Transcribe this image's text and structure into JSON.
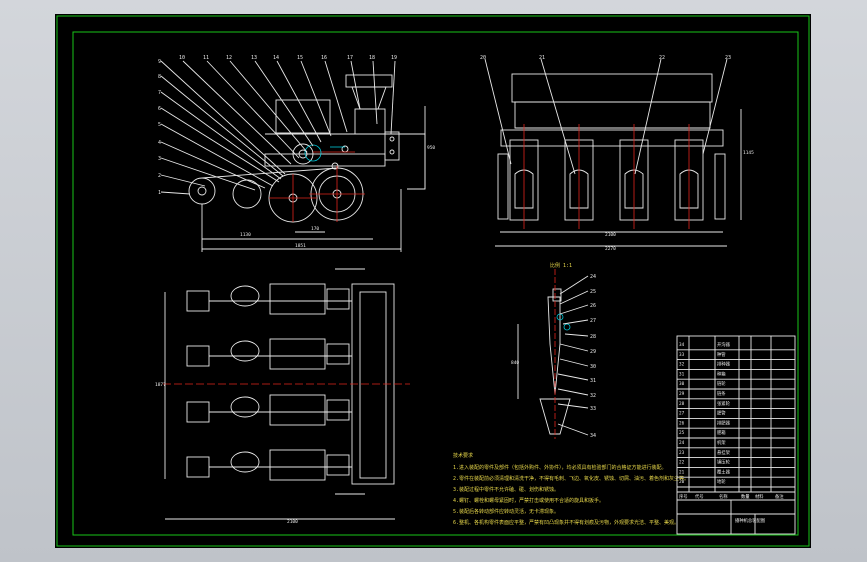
{
  "title_block": {
    "drawing_name": "播种机总装配图",
    "header_cols": [
      "序号",
      "代号",
      "名称",
      "数量",
      "材料",
      "备注"
    ],
    "parts": [
      {
        "no": "34",
        "name": "开沟器"
      },
      {
        "no": "33",
        "name": "种管"
      },
      {
        "no": "32",
        "name": "排种器"
      },
      {
        "no": "31",
        "name": "种箱"
      },
      {
        "no": "30",
        "name": "链轮"
      },
      {
        "no": "29",
        "name": "链条"
      },
      {
        "no": "28",
        "name": "张紧轮"
      },
      {
        "no": "27",
        "name": "肥管"
      },
      {
        "no": "26",
        "name": "排肥器"
      },
      {
        "no": "25",
        "name": "肥箱"
      },
      {
        "no": "24",
        "name": "机架"
      },
      {
        "no": "23",
        "name": "悬挂架"
      },
      {
        "no": "22",
        "name": "镇压轮"
      },
      {
        "no": "21",
        "name": "覆土器"
      },
      {
        "no": "20",
        "name": "地轮"
      }
    ]
  },
  "tech_requirements": {
    "heading": "技术要求",
    "items": [
      "1.进入装配的零件及部件（包括外购件、外协件），均必须具有检验部门的合格证方能进行装配。",
      "2.零件在装配前必须清理和清洗干净，不得有毛刺、飞边、氧化皮、锈蚀、切屑、油污、着色剂和灰尘等。",
      "3.装配过程中零件不允许磕、碰、划伤和锈蚀。",
      "4.螺钉、螺栓和螺母紧固时，严禁打击或使用不合适的旋具和扳手。",
      "5.装配后各转动部件应转动灵活，无卡滞现象。",
      "6.整机、各机构零件表面应平整，严禁有凹凸现象并不得有划痕及污物，外观要求光洁、平整、美观。"
    ]
  },
  "dimensions": {
    "side_total": "1851",
    "side_inner": "1130",
    "side_small": "170",
    "side_height": "950",
    "front_width": "2270",
    "front_inner": "2100",
    "front_height": "1145",
    "plan_width": "2100",
    "plan_depth": "1877",
    "detail_height": "840"
  },
  "balloons_side": [
    "9",
    "8",
    "7",
    "6",
    "5",
    "4",
    "3",
    "2",
    "1",
    "10",
    "11",
    "12",
    "13",
    "14",
    "15",
    "16",
    "17",
    "18",
    "19"
  ],
  "balloons_front": [
    "20",
    "21",
    "22",
    "23"
  ],
  "balloons_detail": [
    "24",
    "25",
    "26",
    "27",
    "28",
    "29",
    "30",
    "31",
    "32",
    "33",
    "34"
  ],
  "scale_label": "比例 1:1",
  "colors": {
    "sheet": "#000000",
    "frame": "#19c319",
    "lines": "#e8e8e8",
    "center": "#e0241c",
    "text": "#e8d84a"
  }
}
